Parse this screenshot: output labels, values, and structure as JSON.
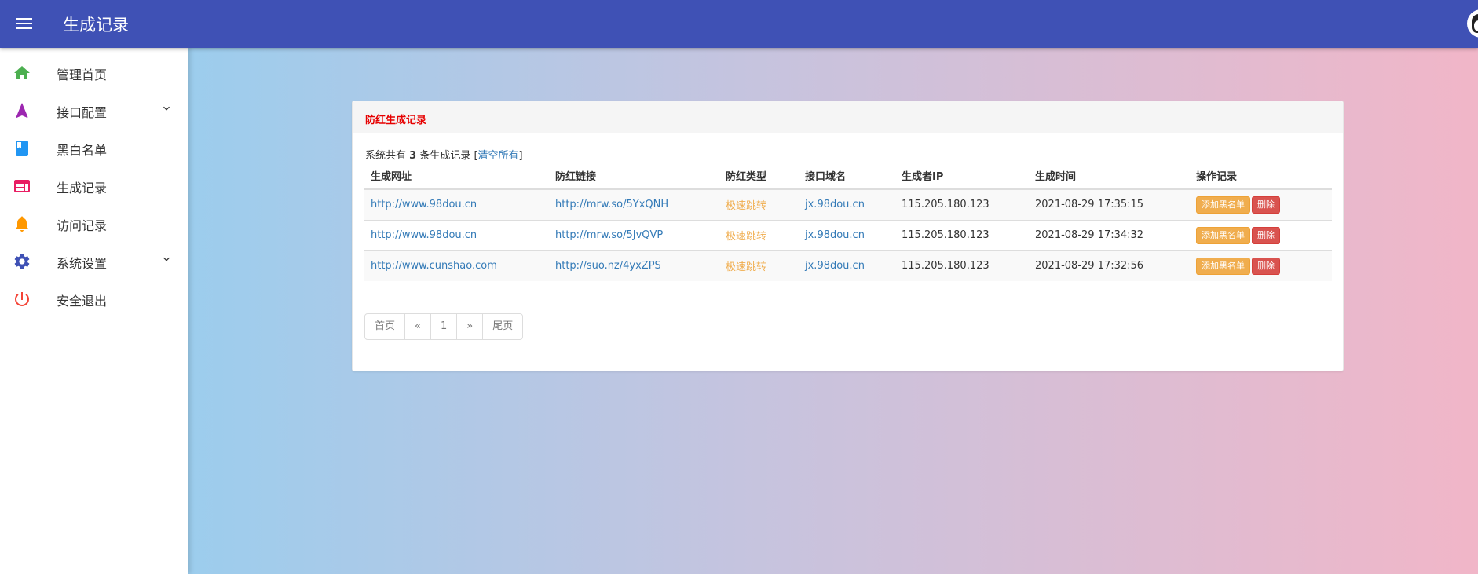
{
  "appbar": {
    "title": "生成记录"
  },
  "sidebar": {
    "items": [
      {
        "label": "管理首页",
        "icon": "home-icon",
        "color": "#4caf50"
      },
      {
        "label": "接口配置",
        "icon": "navigation-icon",
        "color": "#9c27b0",
        "expandable": true
      },
      {
        "label": "黑白名单",
        "icon": "book-icon",
        "color": "#2196f3"
      },
      {
        "label": "生成记录",
        "icon": "web-icon",
        "color": "#e91e63"
      },
      {
        "label": "访问记录",
        "icon": "bell-icon",
        "color": "#ff9800"
      },
      {
        "label": "系统设置",
        "icon": "gear-icon",
        "color": "#3f51b5",
        "expandable": true
      },
      {
        "label": "安全退出",
        "icon": "power-icon",
        "color": "#f44336"
      }
    ]
  },
  "panel": {
    "title": "防红生成记录",
    "summary_prefix": "系统共有 ",
    "summary_count": "3",
    "summary_suffix": " 条生成记录 [",
    "clear_all": "清空所有",
    "summary_end": "]"
  },
  "table": {
    "columns": [
      "生成网址",
      "防红链接",
      "防红类型",
      "接口域名",
      "生成者IP",
      "生成时间",
      "操作记录"
    ],
    "rows": [
      {
        "url": "http://www.98dou.cn",
        "short": "http://mrw.so/5YxQNH",
        "type": "极速跳转",
        "domain": "jx.98dou.cn",
        "ip": "115.205.180.123",
        "time": "2021-08-29 17:35:15"
      },
      {
        "url": "http://www.98dou.cn",
        "short": "http://mrw.so/5JvQVP",
        "type": "极速跳转",
        "domain": "jx.98dou.cn",
        "ip": "115.205.180.123",
        "time": "2021-08-29 17:34:32"
      },
      {
        "url": "http://www.cunshao.com",
        "short": "http://suo.nz/4yxZPS",
        "type": "极速跳转",
        "domain": "jx.98dou.cn",
        "ip": "115.205.180.123",
        "time": "2021-08-29 17:32:56"
      }
    ],
    "blacklist_label": "添加黑名单",
    "delete_label": "删除"
  },
  "pagination": {
    "first": "首页",
    "prev": "«",
    "page": "1",
    "next": "»",
    "last": "尾页"
  }
}
